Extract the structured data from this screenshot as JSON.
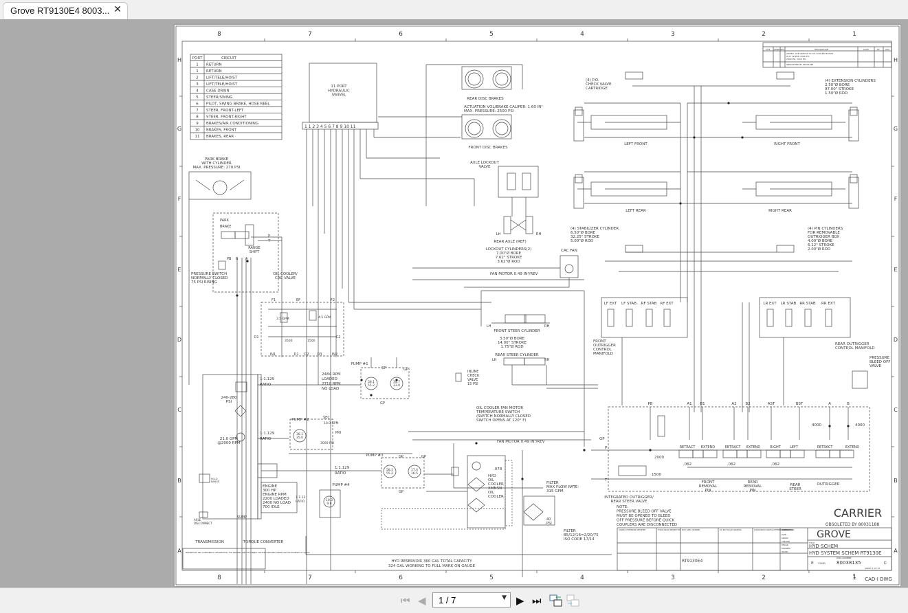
{
  "viewer": {
    "tab_title": "Grove RT9130E4 8003...",
    "page_indicator": "1 / 7",
    "icons": [
      "close-icon",
      "first-page-icon",
      "previous-page-icon",
      "dropdown-caret-icon",
      "next-page-icon",
      "last-page-icon",
      "view-previous-icon",
      "view-next-icon"
    ]
  },
  "drawing": {
    "border": {
      "columns": [
        "8",
        "7",
        "6",
        "5",
        "4",
        "3",
        "2",
        "1"
      ],
      "rows": [
        "H",
        "G",
        "F",
        "E",
        "D",
        "C",
        "B",
        "A"
      ]
    },
    "revisions": {
      "headers": [
        "SYM",
        "ZONE",
        "REV",
        "DESCRIPTION",
        "DATE",
        "BY",
        "APV"
      ],
      "row1": [
        "ADDED .078 ORIFICE TO OIL COOLER MOTOR",
        "OUT; ADDED 2000 PSI",
        "2800 PSI; 1500 PSI"
      ],
      "row2": "OBSOLETED BY 80031188"
    },
    "port_table": {
      "headers": [
        "PORT",
        "CIRCUIT"
      ],
      "rows": [
        [
          "1",
          "RETURN"
        ],
        [
          "1",
          "RETURN"
        ],
        [
          "2",
          "LIFT/TELE/HOIST"
        ],
        [
          "3",
          "LIFT/TELE/HOIST"
        ],
        [
          "4",
          "CASE DRAIN"
        ],
        [
          "5",
          "STEER/SWING"
        ],
        [
          "6",
          "PILOT, SWING BRAKE, HOSE REEL"
        ],
        [
          "7",
          "STEER, FRONT-LEFT"
        ],
        [
          "8",
          "STEER, FRONT-RIGHT"
        ],
        [
          "9",
          "BRAKES/AIR CONDITIONING"
        ],
        [
          "10",
          "BRAKES, FRONT"
        ],
        [
          "11",
          "BRAKES, REAR"
        ]
      ]
    },
    "labels": {
      "swivel": [
        "11 PORT",
        "HYDRAULIC",
        "SWIVEL"
      ],
      "swivel_ports": "1 1 2 3 4 5 6 7 8 9 10 11",
      "rear_disc_brakes": "REAR DISC BRAKES",
      "actuation": [
        "ACTUATION VOL/BRAKE CALIPER: 1.60 IN³",
        "MAX. PRESSURE: 2500 PSI"
      ],
      "front_disc_brakes": "FRONT DISC BRAKES",
      "axle_lockout": [
        "AXLE LOCKOUT",
        "VALVE"
      ],
      "rear_axle": "REAR AXLE (REF)",
      "lockout_cyl": [
        "LOCKOUT CYLINDERS(2)",
        "7.00\"Ø BORE",
        "7.62\" STROKE",
        "3.62\"Ø ROD"
      ],
      "cac_fan": "CAC FAN",
      "fan_motor_top": "FAN MOTOR 0.49 IN³/REV",
      "front_steer": "FRONT STEER CYLINDER",
      "steer_spec": [
        "3.50\"Ø BORE",
        "14.00\" STROKE",
        "1.75\"Ø ROD"
      ],
      "rear_steer": "REAR STEER CYLINDER",
      "lh": "LH",
      "rh": "RH",
      "inline_check": [
        "INLINE",
        "CHECK",
        "VALVE",
        "15 PSI"
      ],
      "po_check": [
        "(4) P.O.",
        "CHECK VALVE",
        "CARTRIDGE"
      ],
      "ext_cyl": [
        "(4) EXTENSION CYLINDERS",
        "2.50\"Ø BORE",
        "97.00\" STROKE",
        "1.50\"Ø ROD"
      ],
      "left_front": "LEFT FRONT",
      "right_front": "RIGHT FRONT",
      "left_rear": "LEFT REAR",
      "right_rear": "RIGHT REAR",
      "stab_cyl": [
        "(4) STABILIZER CYLINDER",
        "6.50\"Ø BORE",
        "32.25\" STROKE",
        "5.00\"Ø ROD"
      ],
      "pin_cyl": [
        "(4) PIN CYLINDERS",
        "FOR REMOVABLE",
        "OUTRIGGER BOX",
        "4.00\"Ø BORE",
        "6.12\" STROKE",
        "2.00\"Ø ROD"
      ],
      "front_manifold_sections": [
        "LF EXT",
        "LF STAB",
        "RF STAB",
        "RF EXT"
      ],
      "rear_manifold_sections": [
        "LR EXT",
        "LR STAB",
        "RR STAB",
        "RR EXT"
      ],
      "front_manifold": [
        "FRONT",
        "OUTRIGGER",
        "CONTROL",
        "MANIFOLD"
      ],
      "rear_manifold": [
        "REAR OUTRIGGER",
        "CONTROL MANIFOLD"
      ],
      "bleed_valve": [
        "PRESSURE",
        "BLEED OFF",
        "VALVE"
      ],
      "valve_ports": [
        "PB",
        "A1",
        "B1",
        "A2",
        "B2",
        "AST",
        "BST",
        "A",
        "B"
      ],
      "valve_sections": [
        "RETRACT",
        "EXTEND",
        "RETRACT",
        "EXTEND",
        "RIGHT",
        "LEFT",
        "RETRACT",
        "EXTEND"
      ],
      "orifices": [
        ".062",
        ".062",
        ".062"
      ],
      "relief": [
        "2000",
        "1500",
        "4000",
        "4000"
      ],
      "gp_p_t": [
        "GP",
        "P",
        "T"
      ],
      "front_pin": [
        "FRONT",
        "REMOVAL",
        "PIN"
      ],
      "rear_pin": [
        "REAR",
        "REMOVAL",
        "PIN"
      ],
      "rear_steer_sec": [
        "REAR",
        "STEER"
      ],
      "outrigger": "OUTRIGGER",
      "integrated_valve": [
        "INTEGRATED OUTRIGGER/",
        "REAR STEER VALVE"
      ],
      "note": [
        "NOTE:",
        "PRESSURE BLEED OFF VALVE",
        "MUST BE OPENED TO BLEED",
        "OFF PRESSURE BEFORE QUICK",
        "COUPLERS ARE DISCONNECTED"
      ],
      "carrier": "CARRIER",
      "obsoleted": "OBSOLETED BY 80031188",
      "park_brake": [
        "PARK BRAKE",
        "WITH CYLINDER",
        "MAX. PRESSURE: 270 PSI"
      ],
      "park_brake_valve": [
        "PARK",
        "BRAKE"
      ],
      "range_shift": [
        "RANGE",
        "SHIFT"
      ],
      "pb_b_a": [
        "PB",
        "B",
        "A",
        "P",
        "T"
      ],
      "pressure_switch": [
        "PRESSURE SWITCH",
        "NORMALLY CLOSED",
        "75 PSI RISING"
      ],
      "oil_cooler_valve": [
        "OIL COOLER/",
        "CAC VALVE"
      ],
      "cac_ports": [
        "F1",
        "EF",
        "F2",
        "O1",
        "C2",
        "IN1",
        "D1",
        "D2",
        "D3",
        "IN2"
      ],
      "cac_values": [
        "3.5 GPM",
        "4.5 GPM",
        "3500",
        "1500"
      ],
      "ratio": [
        "1:1.129",
        "RATIO"
      ],
      "ratio_small": [
        "1:1.13",
        "RATIO"
      ],
      "rpm": [
        "2484 RPM",
        "LOADED",
        "2710 RPM",
        "NO LOAD"
      ],
      "pump1": "PUMP #1",
      "pump2": "PUMP #2",
      "pump3": "PUMP #3",
      "pump4": "PUMP #4",
      "pump1_disp": [
        [
          "58.1",
          "55.2"
        ],
        [
          "34.7",
          "33.0"
        ]
      ],
      "pump2_disp": [
        "36.1",
        "35.0"
      ],
      "pump3_disp": [
        [
          "58.1",
          "55.2"
        ],
        [
          "17.4",
          "16.5"
        ]
      ],
      "pump4_disp": [
        "10.3",
        "9.8"
      ],
      "pump2_flow": [
        "SEC",
        "PRI",
        "10.0 GPM",
        "3000 PSI"
      ],
      "gp": "GP",
      "psi_range": [
        "240-280",
        "PSI"
      ],
      "gpm_rpm": [
        "21.0 GPM",
        "@2000 RPM"
      ],
      "hi_lo": [
        "HI-LO",
        "RANGE"
      ],
      "axle_disconnect": [
        "AXLE",
        "DISCONNECT"
      ],
      "engine": [
        "ENGINE",
        "300 HP",
        "ENGINE RPM",
        "2200 LOADED",
        "2400 NO LOAD",
        "700 IDLE"
      ],
      "temp_switch": [
        "OIL COOLER FAN MOTOR",
        "TEMPERATURE SWITCH",
        "(SWITCH NORMALLY CLOSED",
        "SWITCH OPENS AT 120° F)"
      ],
      "fan_motor_low": "FAN MOTOR 0.49 IN³/REV",
      "coolers": [
        "HYD",
        "OIL",
        "COOLER",
        "XMNSN",
        "OIL",
        "COOLER"
      ],
      "orifice_078": ".078",
      "filter_top": [
        "FILTER",
        "MAX FLOW RATE:",
        "315 GPM"
      ],
      "filter_psi": [
        "40",
        "PSI"
      ],
      "filter_bottom": [
        "FILTER",
        "B5/12/16=2/20/75",
        "ISO CODE 17/14"
      ],
      "transmission": "TRANSMISSION",
      "sump": "SUMP",
      "torque_converter": "TORQUE CONVERTER",
      "reservoir": [
        "HYD RESERVOIR 360 GAL TOTAL CAPACITY",
        "324 GAL WORKING TO FULL MARK ON GAUGE"
      ],
      "proprietary": "PROPRIETARY AND CONFIDENTIAL INFORMATION. THIS DRAWING AND THE SUBJECT MATTER CONTAINED HEREIN ARE THE PROPERTY OF GROVE."
    },
    "title_block": {
      "logo": "GROVE",
      "title_label": "TITLE",
      "title1": "HYD SCHEM",
      "title2": "HYD SYSTEM SCHEM RT9130E",
      "size": "E",
      "cage_code": "12461",
      "dwg_number_label": "DWG NUMBER",
      "dwg_number": "80038135",
      "rev": "C",
      "sheet": "SHEET 1 OF 07",
      "model": "RT9130E4",
      "cad": "CAD-I DWG",
      "sheet_num": "1",
      "fields": [
        "UNLESS OTHERWISE SPECIFIED",
        "THIRD ANGLE PROJECTION",
        "MATL SPEC. NUMBER",
        "DO NOT SCALE DRAWING",
        "TOLERANCES UNLESS OTHERWISE SPECIFIED",
        "APPROVALS",
        "DATE",
        "CONTRACT NO.",
        "DRAWN",
        "CHECKED",
        "DESIGN",
        "ENGINEER",
        "ISSUED"
      ]
    }
  }
}
